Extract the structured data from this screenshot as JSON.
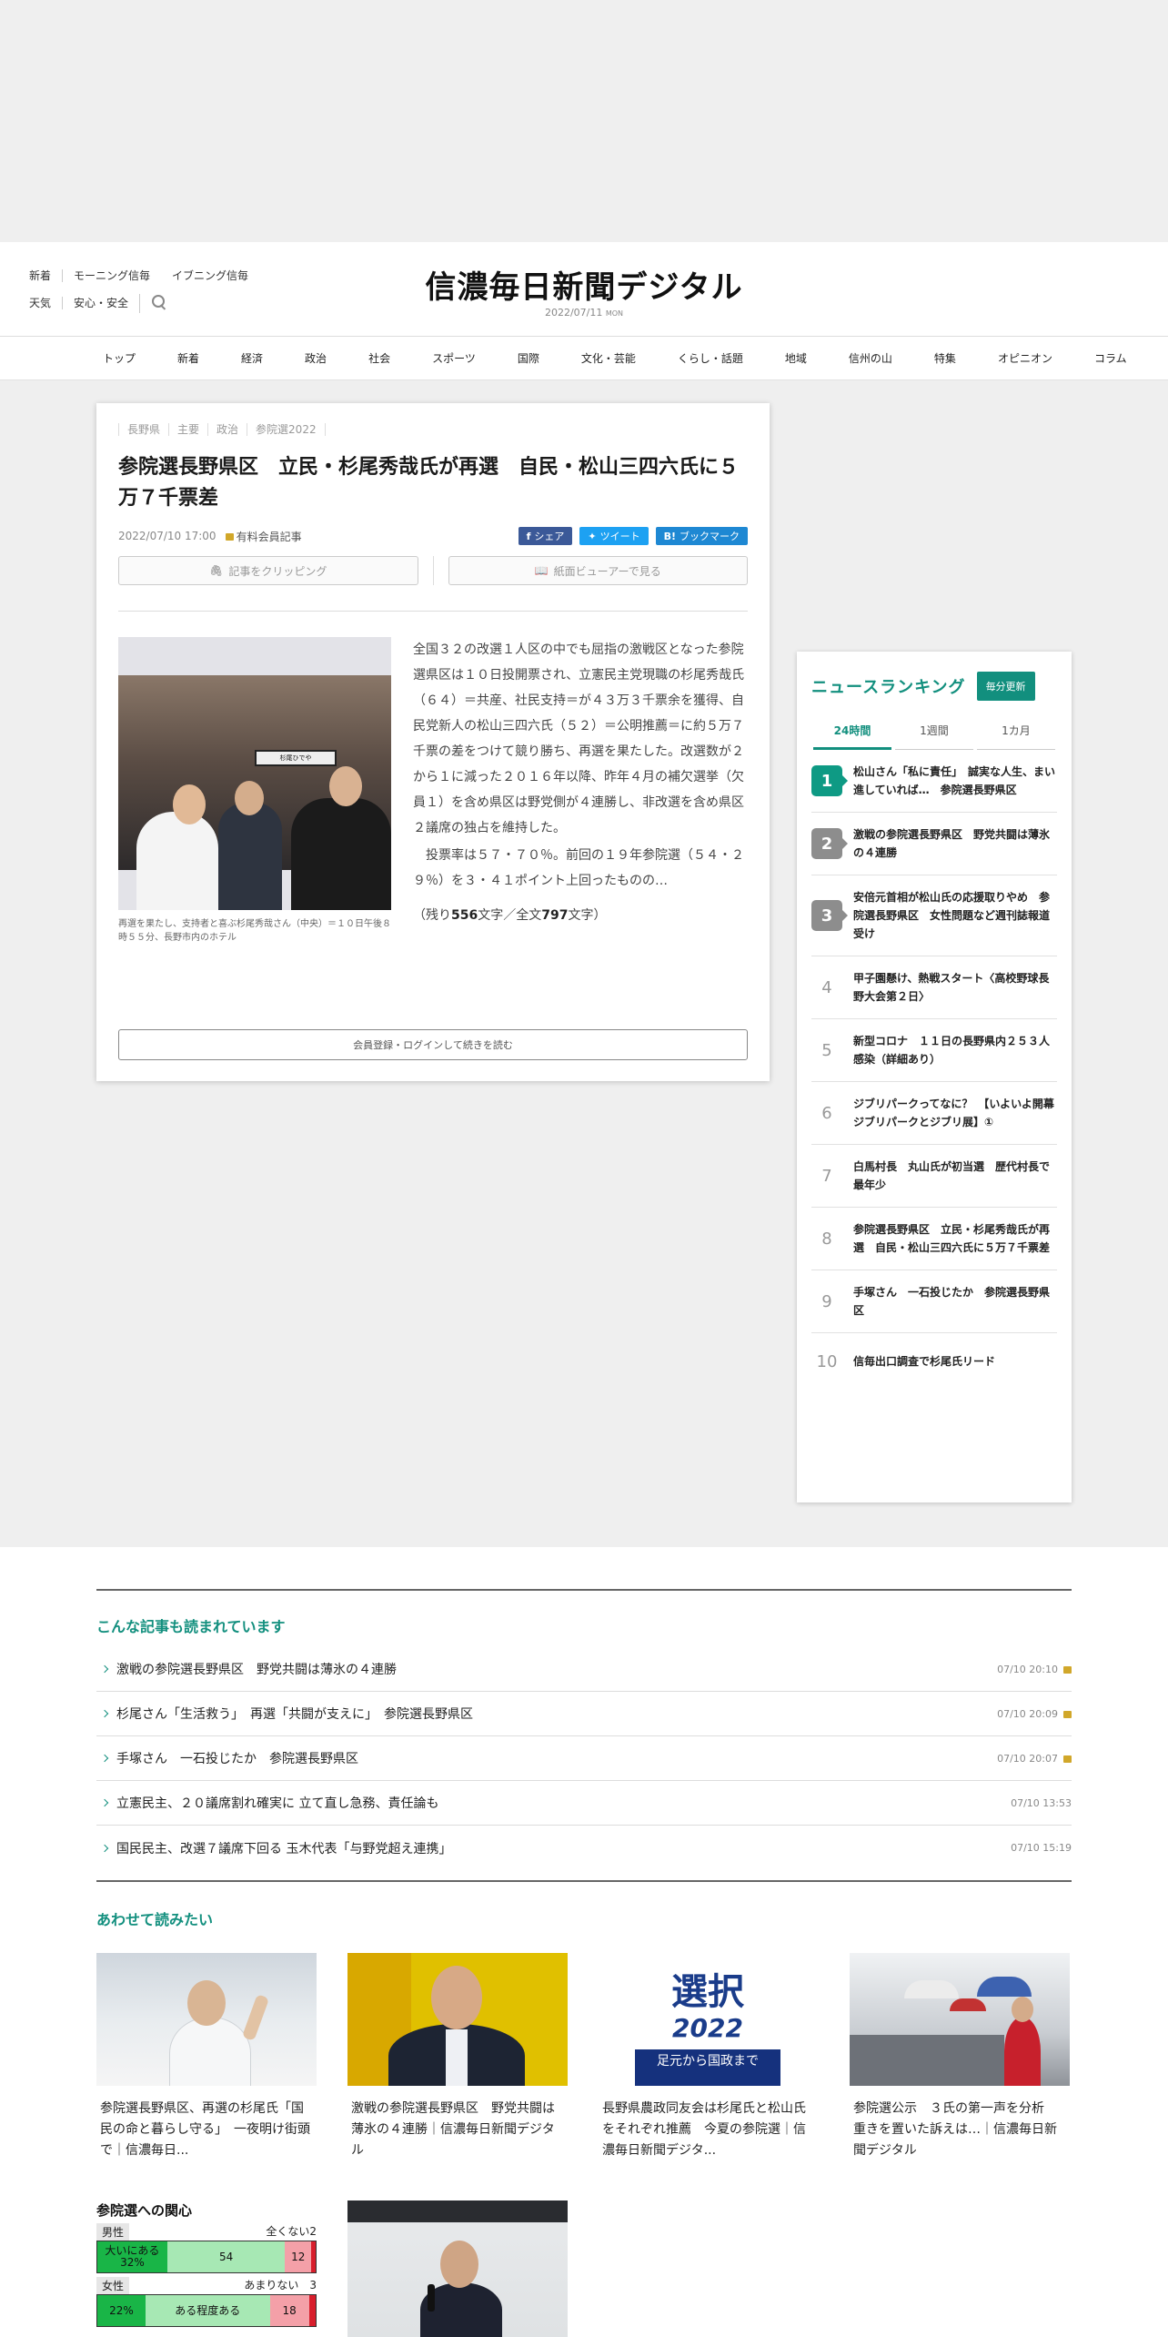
{
  "header": {
    "links_row1": [
      "新着",
      "モーニング信毎",
      "イブニング信毎"
    ],
    "links_row2": [
      "天気",
      "安心・安全"
    ],
    "logo": "信濃毎日新聞デジタル",
    "date": "2022/07/11",
    "weekday": "MON"
  },
  "nav": [
    "トップ",
    "新着",
    "経済",
    "政治",
    "社会",
    "スポーツ",
    "国際",
    "文化・芸能",
    "くらし・話題",
    "地域",
    "信州の山",
    "特集",
    "オピニオン",
    "コラム"
  ],
  "article": {
    "crumbs": [
      "長野県",
      "主要",
      "政治",
      "参院選2022"
    ],
    "headline": "参院選長野県区　立民・杉尾秀哉氏が再選　自民・松山三四六氏に５万７千票差",
    "datetime": "2022/07/10 17:00",
    "members_label": "有料会員記事",
    "share_fb": "シェア",
    "share_tw": "ツイート",
    "share_hb": "ブックマーク",
    "clip_button": "記事をクリッピング",
    "viewer_button": "紙面ビューアーで見る",
    "photo_banner": "杉尾ひでや",
    "caption": "再選を果たし、支持者と喜ぶ杉尾秀哉さん（中央）＝１０日午後８時５５分、長野市内のホテル",
    "para1": "全国３２の改選１人区の中でも屈指の激戦区となった参院選県区は１０日投開票され、立憲民主党現職の杉尾秀哉氏（６４）＝共産、社民支持＝が４３万３千票余を獲得、自民党新人の松山三四六氏（５２）＝公明推薦＝に約５万７千票の差をつけて競り勝ち、再選を果たした。改選数が２から１に減った２０１６年以降、昨年４月の補欠選挙（欠員１）を含め県区は野党側が４連勝し、非改選を含め県区２議席の独占を維持した。",
    "para2": "投票率は５７・７０％。前回の１９年参院選（５４・２９％）を３・４１ポイント上回ったものの…",
    "remain_prefix": "（残り",
    "remain_chars": "556",
    "remain_mid": "文字／全文",
    "total_chars": "797",
    "remain_suffix": "文字）",
    "readmore": "会員登録・ログインして続きを読む"
  },
  "ranking": {
    "title": "ニュースランキング",
    "badge": "毎分更新",
    "tabs": [
      "24時間",
      "1週間",
      "1カ月"
    ],
    "items": [
      {
        "num": "1",
        "text": "松山さん「私に責任」　誠実な人生、まい進していれば…　参院選長野県区"
      },
      {
        "num": "2",
        "text": "激戦の参院選長野県区　野党共闘は薄氷の４連勝"
      },
      {
        "num": "3",
        "text": "安倍元首相が松山氏の応援取りやめ　参院選長野県区　女性問題など週刊誌報道受け"
      },
      {
        "num": "4",
        "text": "甲子園懸け、熱戦スタート〈高校野球長野大会第２日〉"
      },
      {
        "num": "5",
        "text": "新型コロナ　１１日の長野県内２５３人感染（詳細あり）"
      },
      {
        "num": "6",
        "text": "ジブリパークってなに？　【いよいよ開幕ジブリパークとジブリ展】①"
      },
      {
        "num": "7",
        "text": "白馬村長　丸山氏が初当選　歴代村長で最年少"
      },
      {
        "num": "8",
        "text": "参院選長野県区　立民・杉尾秀哉氏が再選　自民・松山三四六氏に５万７千票差"
      },
      {
        "num": "9",
        "text": "手塚さん　一石投じたか　参院選長野県区"
      },
      {
        "num": "10",
        "text": "信毎出口調査で杉尾氏リード"
      }
    ]
  },
  "related": {
    "title": "こんな記事も読まれています",
    "items": [
      {
        "text": "激戦の参院選長野県区　野党共闘は薄氷の４連勝",
        "date": "07/10 20:10",
        "locked": true
      },
      {
        "text": "杉尾さん「生活救う」　再選「共闘が支えに」　参院選長野県区",
        "date": "07/10 20:09",
        "locked": true
      },
      {
        "text": "手塚さん　一石投じたか　参院選長野県区",
        "date": "07/10 20:07",
        "locked": true
      },
      {
        "text": "立憲民主、２０議席割れ確実に 立て直し急務、責任論も",
        "date": "07/10 13:53",
        "locked": false
      },
      {
        "text": "国民民主、改選７議席下回る 玉木代表「与野党超え連携」",
        "date": "07/10 15:19",
        "locked": false
      }
    ]
  },
  "also_read": {
    "title": "あわせて読みたい",
    "cards": [
      {
        "title": "参院選長野県区、再選の杉尾氏「国民の命と暮らし守る」　一夜明け街頭で｜信濃毎日..."
      },
      {
        "title": "激戦の参院選長野県区　野党共闘は薄氷の４連勝｜信濃毎日新聞デジタル"
      },
      {
        "title": "長野県農政同友会は杉尾氏と松山氏をそれぞれ推薦　今夏の参院選｜信濃毎日新聞デジタ..."
      },
      {
        "title": "参院選公示　３氏の第一声を分析　重きを置いた訴えは…｜信濃毎日新聞デジタル"
      }
    ],
    "card3_big": "選択",
    "card3_year": "2022",
    "card3_sub": "足元から国政まで"
  },
  "poll": {
    "title": "参院選への関心",
    "row1_label": "男性",
    "row1_note": "全くない2",
    "row1_seg1": "大いにある 32%",
    "row1_seg2": "54",
    "row1_seg3": "12",
    "row2_label": "女性",
    "row2_note": "あまりない　3",
    "row2_seg1": "22%",
    "row2_seg2": "ある程度ある",
    "row2_seg3": "18"
  },
  "colors": {
    "accent": "#128f7e",
    "facebook": "#3b5998",
    "twitter": "#1da1f2",
    "hatena": "#1e88d3",
    "lock": "#d1a72a"
  }
}
